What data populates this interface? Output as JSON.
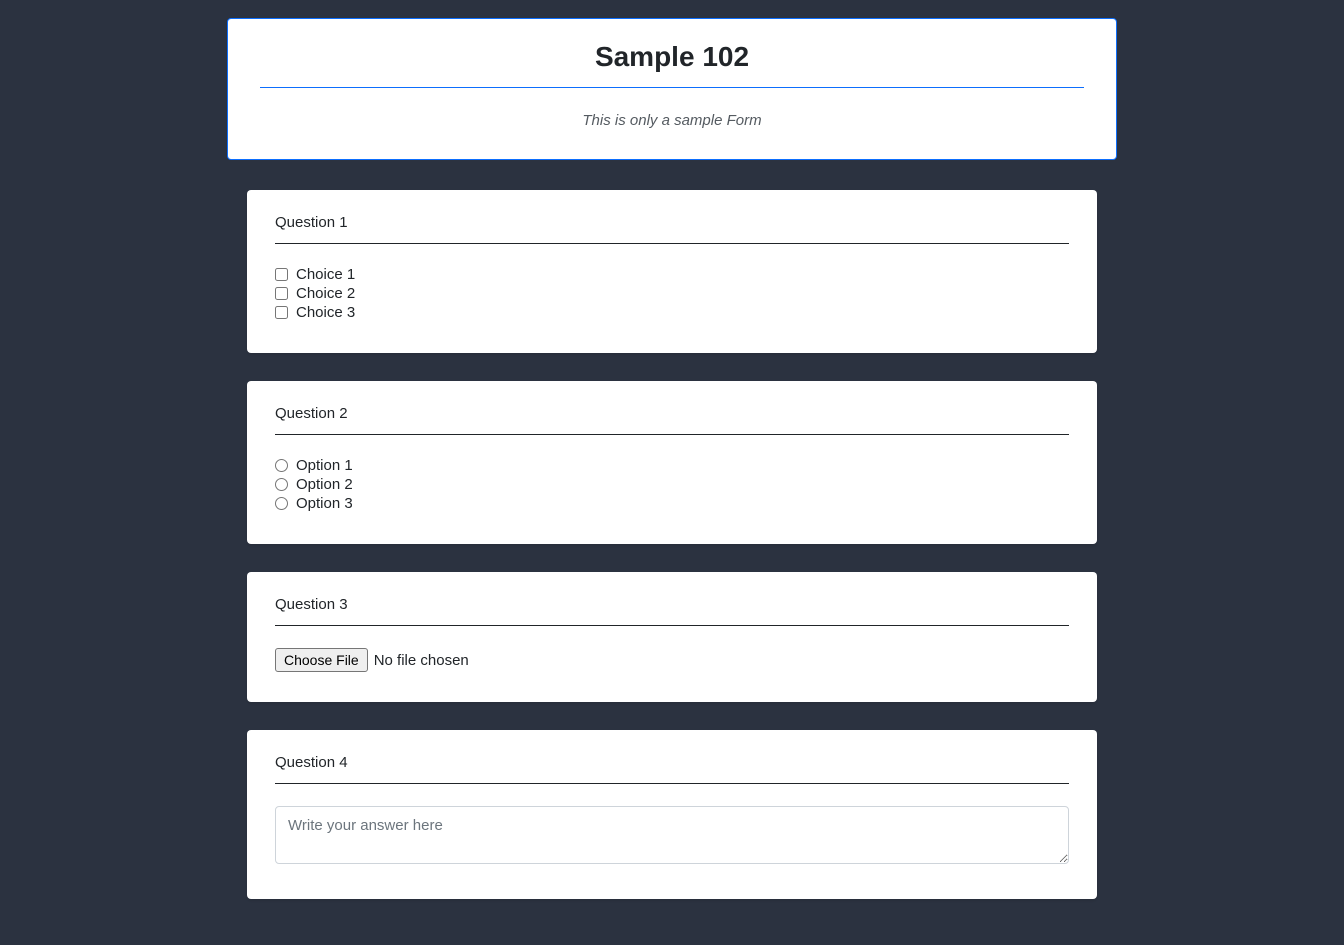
{
  "header": {
    "title": "Sample 102",
    "description": "This is only a sample Form"
  },
  "questions": {
    "q1": {
      "title": "Question 1",
      "choices": [
        "Choice 1",
        "Choice 2",
        "Choice 3"
      ]
    },
    "q2": {
      "title": "Question 2",
      "options": [
        "Option 1",
        "Option 2",
        "Option 3"
      ]
    },
    "q3": {
      "title": "Question 3",
      "file_button": "Choose File",
      "file_status": "No file chosen"
    },
    "q4": {
      "title": "Question 4",
      "placeholder": "Write your answer here"
    }
  }
}
